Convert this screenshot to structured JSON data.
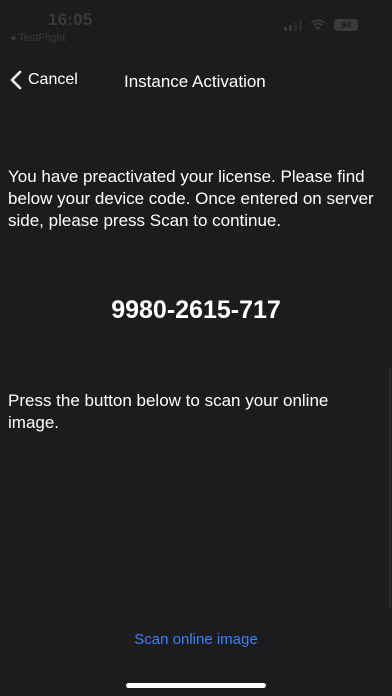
{
  "status_bar": {
    "time": "16:05",
    "back_app": "◂ TestFlight",
    "battery": "94"
  },
  "nav": {
    "cancel_label": "Cancel",
    "title": "Instance Activation"
  },
  "content": {
    "info_text": "You have preactivated your license. Please find below your device code. Once entered on server side, please press Scan to continue.",
    "device_code": "9980-2615-717",
    "instruction_text": "Press the button below to scan your online image.",
    "scan_button_label": "Scan online image"
  },
  "colors": {
    "background": "#1c1c1e",
    "accent": "#3a82f7",
    "text": "#ffffff"
  }
}
